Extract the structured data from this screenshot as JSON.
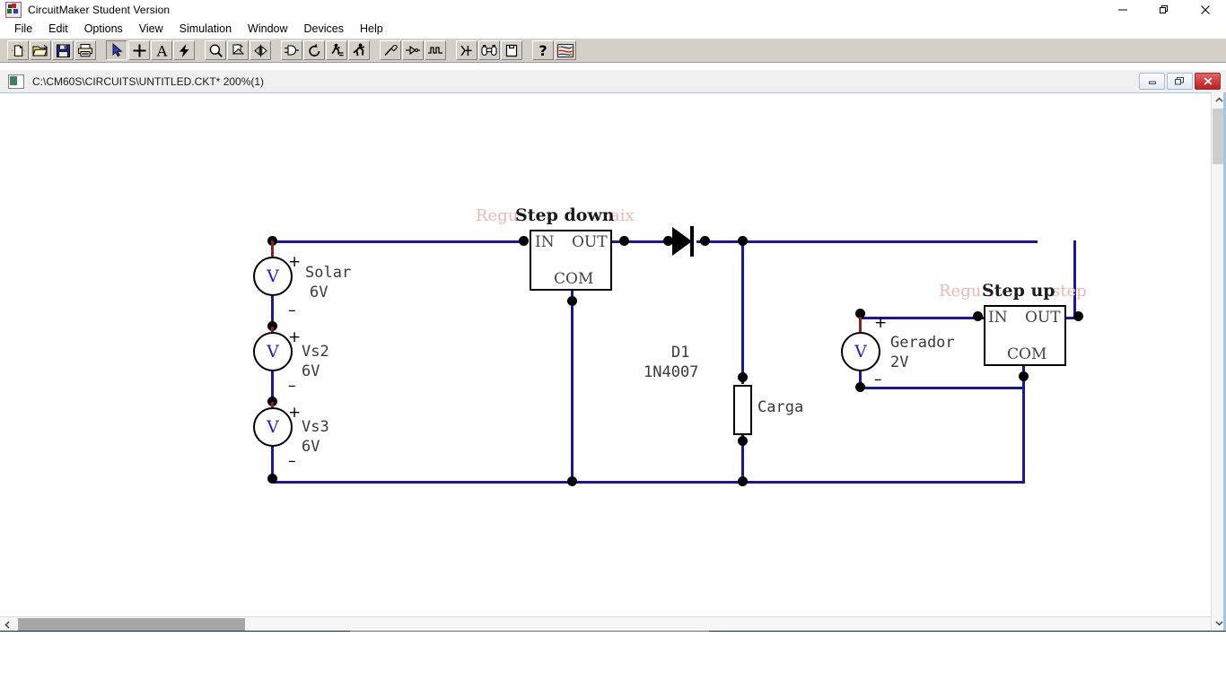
{
  "window": {
    "title": "CircuitMaker Student Version",
    "icon": "circuitmaker-app-icon",
    "minimize": "–",
    "maximize": "❐",
    "close": "✕"
  },
  "menubar": {
    "items": [
      {
        "label": "File"
      },
      {
        "label": "Edit"
      },
      {
        "label": "Options"
      },
      {
        "label": "View"
      },
      {
        "label": "Simulation"
      },
      {
        "label": "Window"
      },
      {
        "label": "Devices"
      },
      {
        "label": "Help"
      }
    ]
  },
  "toolbar": {
    "groups": [
      {
        "buttons": [
          {
            "name": "new-file-icon",
            "tip": "New"
          },
          {
            "name": "open-file-icon",
            "tip": "Open"
          },
          {
            "name": "save-file-icon",
            "tip": "Save"
          },
          {
            "name": "print-icon",
            "tip": "Print"
          }
        ]
      },
      {
        "buttons": [
          {
            "name": "arrow-select-icon",
            "tip": "Arrow",
            "pressed": true
          },
          {
            "name": "wire-plus-icon",
            "tip": "Wire"
          },
          {
            "name": "text-tool-icon",
            "tip": "Text"
          },
          {
            "name": "lightning-probe-icon",
            "tip": "Probe"
          }
        ]
      },
      {
        "buttons": [
          {
            "name": "zoom-magnifier-icon",
            "tip": "Zoom"
          },
          {
            "name": "page-rotate-icon",
            "tip": "Rotate"
          },
          {
            "name": "mirror-flip-icon",
            "tip": "Mirror"
          }
        ]
      },
      {
        "buttons": [
          {
            "name": "logic-gate-icon",
            "tip": "Device"
          },
          {
            "name": "undo-circular-icon",
            "tip": "Undo"
          },
          {
            "name": "step-run-icon",
            "tip": "Step"
          },
          {
            "name": "run-simulation-icon",
            "tip": "Run"
          }
        ]
      },
      {
        "buttons": [
          {
            "name": "hand-probe-icon",
            "tip": "Probe tool"
          },
          {
            "name": "signal-source-icon",
            "tip": "Source"
          },
          {
            "name": "waveform-icon",
            "tip": "Waveform"
          }
        ]
      },
      {
        "buttons": [
          {
            "name": "netlist-icon",
            "tip": "Netlist"
          },
          {
            "name": "binoculars-find-icon",
            "tip": "Find"
          },
          {
            "name": "macro-icon",
            "tip": "Macro"
          }
        ]
      },
      {
        "buttons": [
          {
            "name": "help-question-icon",
            "tip": "Help"
          },
          {
            "name": "circuit-board-icon",
            "tip": "About"
          }
        ]
      }
    ]
  },
  "document": {
    "title": "C:\\CM60S\\CIRCUITS\\UNTITLED.CKT* 200%(1)",
    "path": "C:\\CM60S\\CIRCUITS\\UNTITLED.CKT*",
    "zoom": "200%",
    "sheet": "(1)",
    "restore_label": "–",
    "maximize_label": "❐",
    "close_label": "✕"
  },
  "schematic": {
    "sources": [
      {
        "id": "solar",
        "name": "Solar",
        "value": "6V",
        "symbol": "V",
        "plus": "+",
        "minus": "–"
      },
      {
        "id": "vs2",
        "name": "Vs2",
        "value": "6V",
        "symbol": "V",
        "plus": "+",
        "minus": "–"
      },
      {
        "id": "vs3",
        "name": "Vs3",
        "value": "6V",
        "symbol": "V",
        "plus": "+",
        "minus": "–"
      },
      {
        "id": "gerador",
        "name": "Gerador",
        "value": "2V",
        "symbol": "V",
        "plus": "+",
        "minus": "–"
      }
    ],
    "blocks": [
      {
        "id": "step-down",
        "title": "Step down",
        "ghost_left": "Regu",
        "ghost_right": "aix",
        "pins": {
          "in": "IN",
          "out": "OUT",
          "com": "COM"
        }
      },
      {
        "id": "step-up",
        "title": "Step up",
        "ghost_left": "Regu",
        "ghost_right": "step",
        "pins": {
          "in": "IN",
          "out": "OUT",
          "com": "COM"
        }
      }
    ],
    "diode": {
      "ref": "D1",
      "part": "1N4007"
    },
    "resistor": {
      "ref": "Carga"
    },
    "colors": {
      "wire": "#1a1a8c",
      "node": "#000000",
      "source_stub": "#8b2020",
      "symbol_text": "#2222aa",
      "label_text": "#3a3a3a",
      "ghost_text": "#e9b9b9"
    }
  },
  "scrollbars": {
    "vertical": {
      "up": "⌃",
      "down": "⌄"
    },
    "horizontal": {
      "left": "‹",
      "right": "›"
    }
  }
}
